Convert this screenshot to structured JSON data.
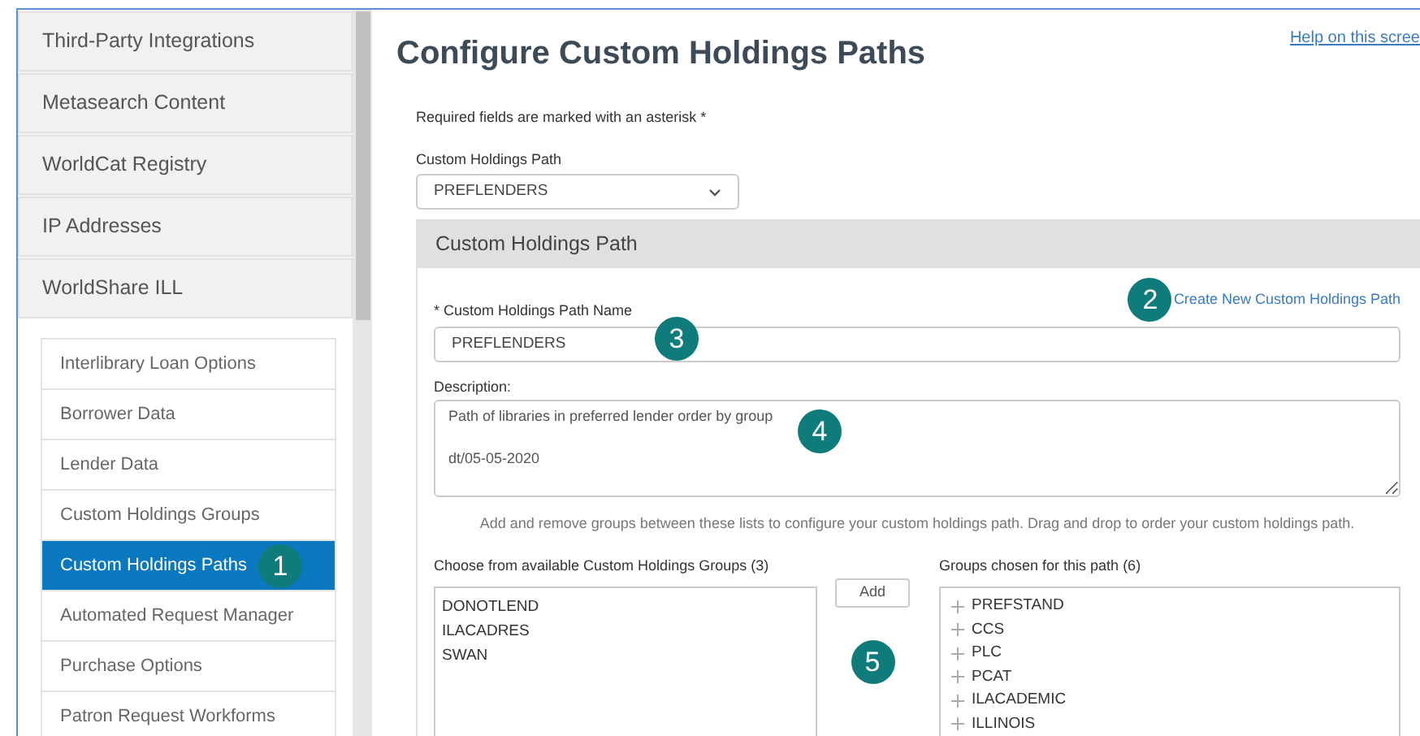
{
  "sidebar": {
    "sections": [
      {
        "label": "Third-Party Integrations"
      },
      {
        "label": "Metasearch Content"
      },
      {
        "label": "WorldCat Registry"
      },
      {
        "label": "IP Addresses"
      },
      {
        "label": "WorldShare ILL",
        "children": [
          {
            "label": "Interlibrary Loan Options",
            "selected": false
          },
          {
            "label": "Borrower Data",
            "selected": false
          },
          {
            "label": "Lender Data",
            "selected": false
          },
          {
            "label": "Custom Holdings Groups",
            "selected": false
          },
          {
            "label": "Custom Holdings Paths",
            "selected": true
          },
          {
            "label": "Automated Request Manager",
            "selected": false
          },
          {
            "label": "Purchase Options",
            "selected": false
          },
          {
            "label": "Patron Request Workforms",
            "selected": false
          }
        ]
      }
    ]
  },
  "page": {
    "title": "Configure Custom Holdings Paths",
    "help_link": "Help on this scree",
    "required_note": "Required fields are marked with an asterisk *",
    "path_select": {
      "label": "Custom Holdings Path",
      "value": "PREFLENDERS"
    }
  },
  "panel": {
    "header": "Custom Holdings Path",
    "create_link": "Create New Custom Holdings Path",
    "name_field": {
      "label": "* Custom Holdings Path Name",
      "value": "PREFLENDERS"
    },
    "description_field": {
      "label": "Description:",
      "value": "Path of libraries in preferred lender order by group\n\ndt/05-05-2020"
    },
    "instructions": "Add and remove groups between these lists to configure your custom holdings path. Drag and drop to order your custom holdings path.",
    "available": {
      "label": "Choose from available Custom Holdings Groups (3)",
      "items": [
        "DONOTLEND",
        "ILACADRES",
        "SWAN"
      ]
    },
    "add_button": "Add",
    "chosen": {
      "label": "Groups chosen for this path (6)",
      "items": [
        "PREFSTAND",
        "CCS",
        "PLC",
        "PCAT",
        "ILACADEMIC",
        "ILLINOIS"
      ]
    }
  },
  "callouts": [
    "1",
    "2",
    "3",
    "4",
    "5"
  ]
}
